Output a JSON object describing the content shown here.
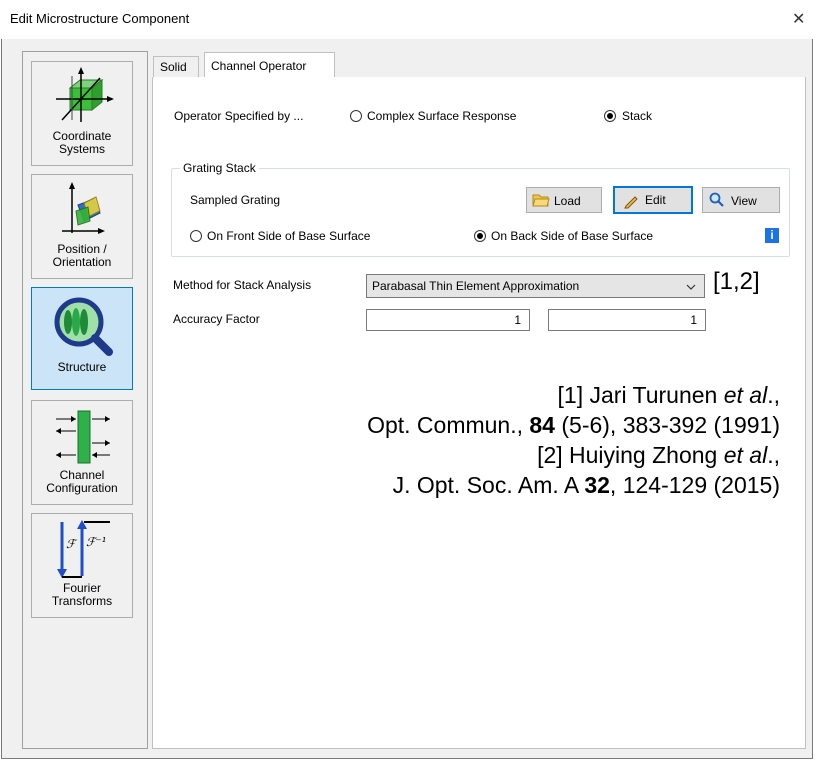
{
  "window": {
    "title": "Edit Microstructure Component",
    "close_glyph": "✕"
  },
  "sidebar": {
    "items": [
      {
        "label1": "Coordinate",
        "label2": "Systems",
        "icon": "coordinate-systems-icon"
      },
      {
        "label1": "Position /",
        "label2": "Orientation",
        "icon": "position-orientation-icon"
      },
      {
        "label1": "Structure",
        "label2": "",
        "icon": "structure-icon",
        "selected": true
      },
      {
        "label1": "Channel",
        "label2": "Configuration",
        "icon": "channel-configuration-icon"
      },
      {
        "label1": "Fourier",
        "label2": "Transforms",
        "icon": "fourier-transforms-icon"
      }
    ]
  },
  "tabs": [
    {
      "label": "Solid"
    },
    {
      "label": "Channel Operator",
      "active": true
    }
  ],
  "operator": {
    "label": "Operator Specified by ...",
    "option_complex": "Complex Surface Response",
    "option_stack": "Stack",
    "selected": "Stack"
  },
  "grating_stack": {
    "legend": "Grating Stack",
    "name": "Sampled Grating",
    "load_label": "Load",
    "edit_label": "Edit",
    "view_label": "View",
    "front_label": "On Front Side of Base Surface",
    "back_label": "On Back Side of Base Surface",
    "selected_side": "back",
    "info_glyph": "i"
  },
  "method": {
    "label": "Method for Stack Analysis",
    "value": "Parabasal Thin Element Approximation",
    "refs": "[1,2]"
  },
  "accuracy": {
    "label": "Accuracy Factor",
    "value1": "1",
    "value2": "1"
  },
  "references": {
    "ref1_prefix": "[1] Jari Turunen ",
    "ref1_etal": "et al",
    "ref1_suffix": ".,",
    "ref1_journal": "Opt. Commun., ",
    "ref1_volume": "84",
    "ref1_rest": " (5-6), 383-392 (1991)",
    "ref2_prefix": "[2] Huiying Zhong ",
    "ref2_etal": "et al",
    "ref2_suffix": ".,",
    "ref2_journal": "J. Opt. Soc. Am. A ",
    "ref2_volume": "32",
    "ref2_rest": ", 124-129 (2015)"
  },
  "colors": {
    "accent": "#0078d7",
    "selected_bg": "#cce4f7",
    "info": "#1a73e8"
  }
}
